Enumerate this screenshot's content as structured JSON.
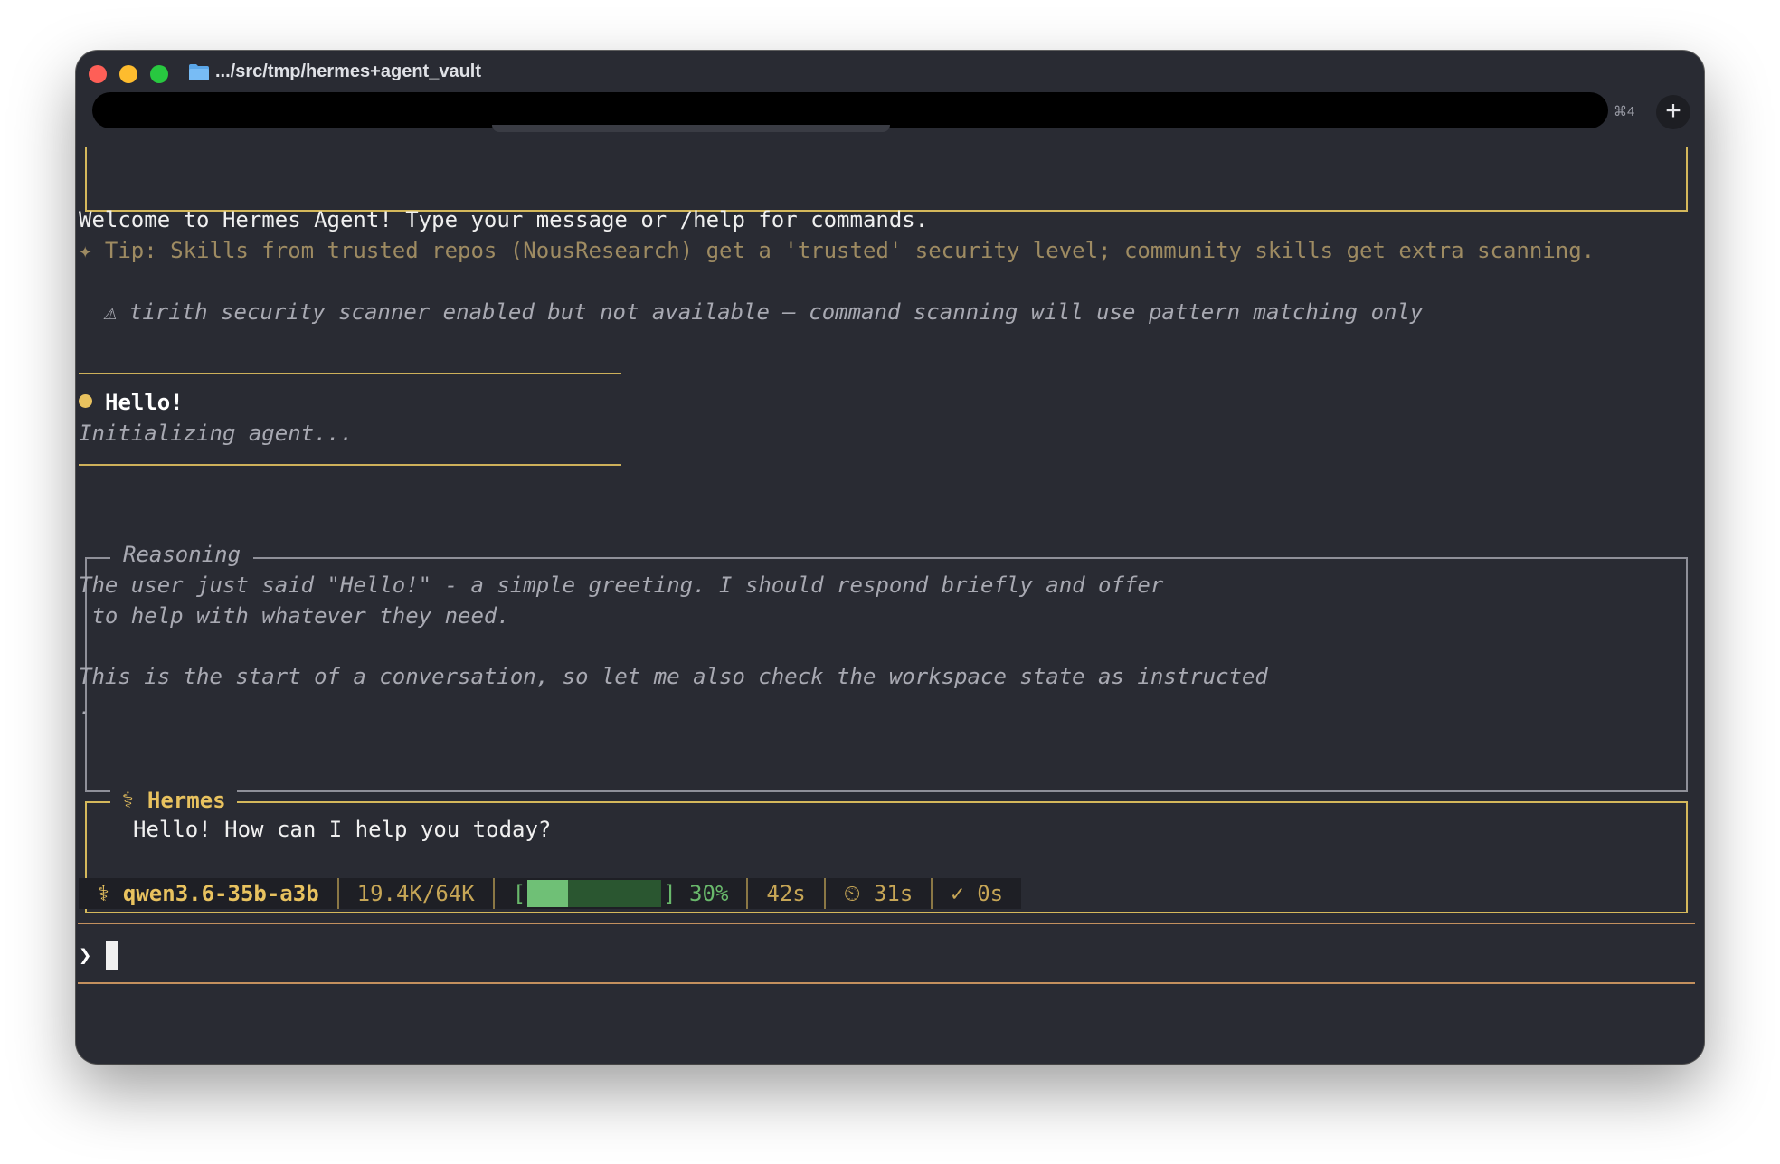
{
  "window": {
    "title": ".../src/tmp/hermes+agent_vault",
    "shortcut": "⌘4",
    "new_tab": "+"
  },
  "welcome": "Welcome to Hermes Agent! Type your message or /help for commands.",
  "tip": "✦ Tip: Skills from trusted repos (NousResearch) get a 'trusted' security level; community skills get extra scanning.",
  "warning": "⚠ tirith security scanner enabled but not available — command scanning will use pattern matching only",
  "user_message": {
    "text": "Hello!",
    "status": "Initializing agent..."
  },
  "reasoning": {
    "label": "Reasoning",
    "lines": [
      "The user just said \"Hello!\" - a simple greeting. I should respond briefly and offer",
      " to help with whatever they need.",
      "",
      "This is the start of a conversation, so let me also check the workspace state as instructed",
      "."
    ]
  },
  "response": {
    "label": "⚕ Hermes",
    "text": "Hello! How can I help you today?"
  },
  "status_bar": {
    "model": "⚕ qwen3.6-35b-a3b",
    "tokens": "19.4K/64K",
    "bar_open": "[",
    "bar_close": "]",
    "percent": "30%",
    "progress": 0.3,
    "elapsed": "42s",
    "timer": "⏲ 31s",
    "done": "✓ 0s"
  },
  "input": {
    "prompt": "❯",
    "value": ""
  },
  "colors": {
    "background": "#292b33",
    "accent_gold": "#e8c25f",
    "tip": "#9e8b62",
    "progress": "#6fc076"
  }
}
